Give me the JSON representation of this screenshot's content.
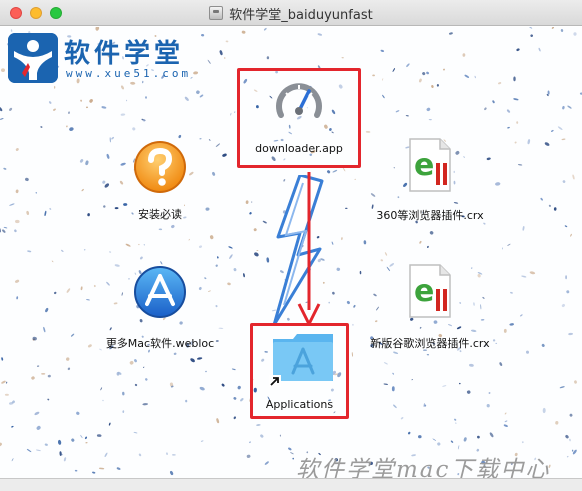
{
  "window": {
    "title": "软件学堂_baiduyunfast"
  },
  "logo": {
    "name": "软件学堂",
    "url": "www.xue51.com"
  },
  "items": {
    "downloader": {
      "label": "downloader.app",
      "icon": "gauge-icon"
    },
    "install_guide": {
      "label": "安装必读",
      "icon": "question-icon"
    },
    "more_mac": {
      "label": "更多Mac软件.webloc",
      "icon": "app-store-icon"
    },
    "applications": {
      "label": "Applications",
      "icon": "applications-folder-icon"
    },
    "crx_360": {
      "label": "360等浏览器插件.crx",
      "icon": "crx-file-icon"
    },
    "crx_chrome": {
      "label": "新版谷歌浏览器插件.crx",
      "icon": "crx-file-icon"
    }
  },
  "watermark": "软件学堂mac下载中心",
  "colors": {
    "highlight": "#e3262d",
    "brand": "#1b64b0",
    "lightning": "#3a7fd6"
  }
}
